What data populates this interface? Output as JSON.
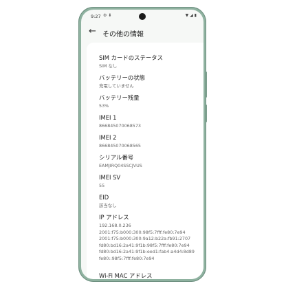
{
  "status_bar": {
    "time": "9:27",
    "left_icons": "⚙ ⬇",
    "right_icons": "▼ ◢ ▮"
  },
  "app_bar": {
    "back_icon": "←",
    "title": "その他の情報"
  },
  "items": [
    {
      "label": "SIM カードのステータス",
      "value": "SIM なし"
    },
    {
      "label": "バッテリーの状態",
      "value": "充電していません"
    },
    {
      "label": "バッテリー残量",
      "value": "53%"
    },
    {
      "label": "IMEI 1",
      "value": "866845070068573"
    },
    {
      "label": "IMEI 2",
      "value": "866845070068565"
    },
    {
      "label": "シリアル番号",
      "value": "EAMJIRQ04SSCJVUS"
    },
    {
      "label": "IMEI SV",
      "value": "55"
    },
    {
      "label": "EID",
      "value": "該当なし"
    },
    {
      "label": "IP アドレス",
      "values": [
        "192.168.0.236",
        "2001:f75:b000:300:98f5:7fff:fe80:7e94",
        "2001:f75:b000:300:9a12:b22a:fb91:2707",
        "fd80:bd16:2a41:9f1b:98f5:7fff:fe80:7e94",
        "fd80:bd16:2a41:9f1b:eed1:fab4:a4d4:8d89",
        "fe80::98f5:7fff:fe80:7e94"
      ]
    },
    {
      "label": "Wi-Fi MAC アドレス",
      "value": ""
    }
  ]
}
